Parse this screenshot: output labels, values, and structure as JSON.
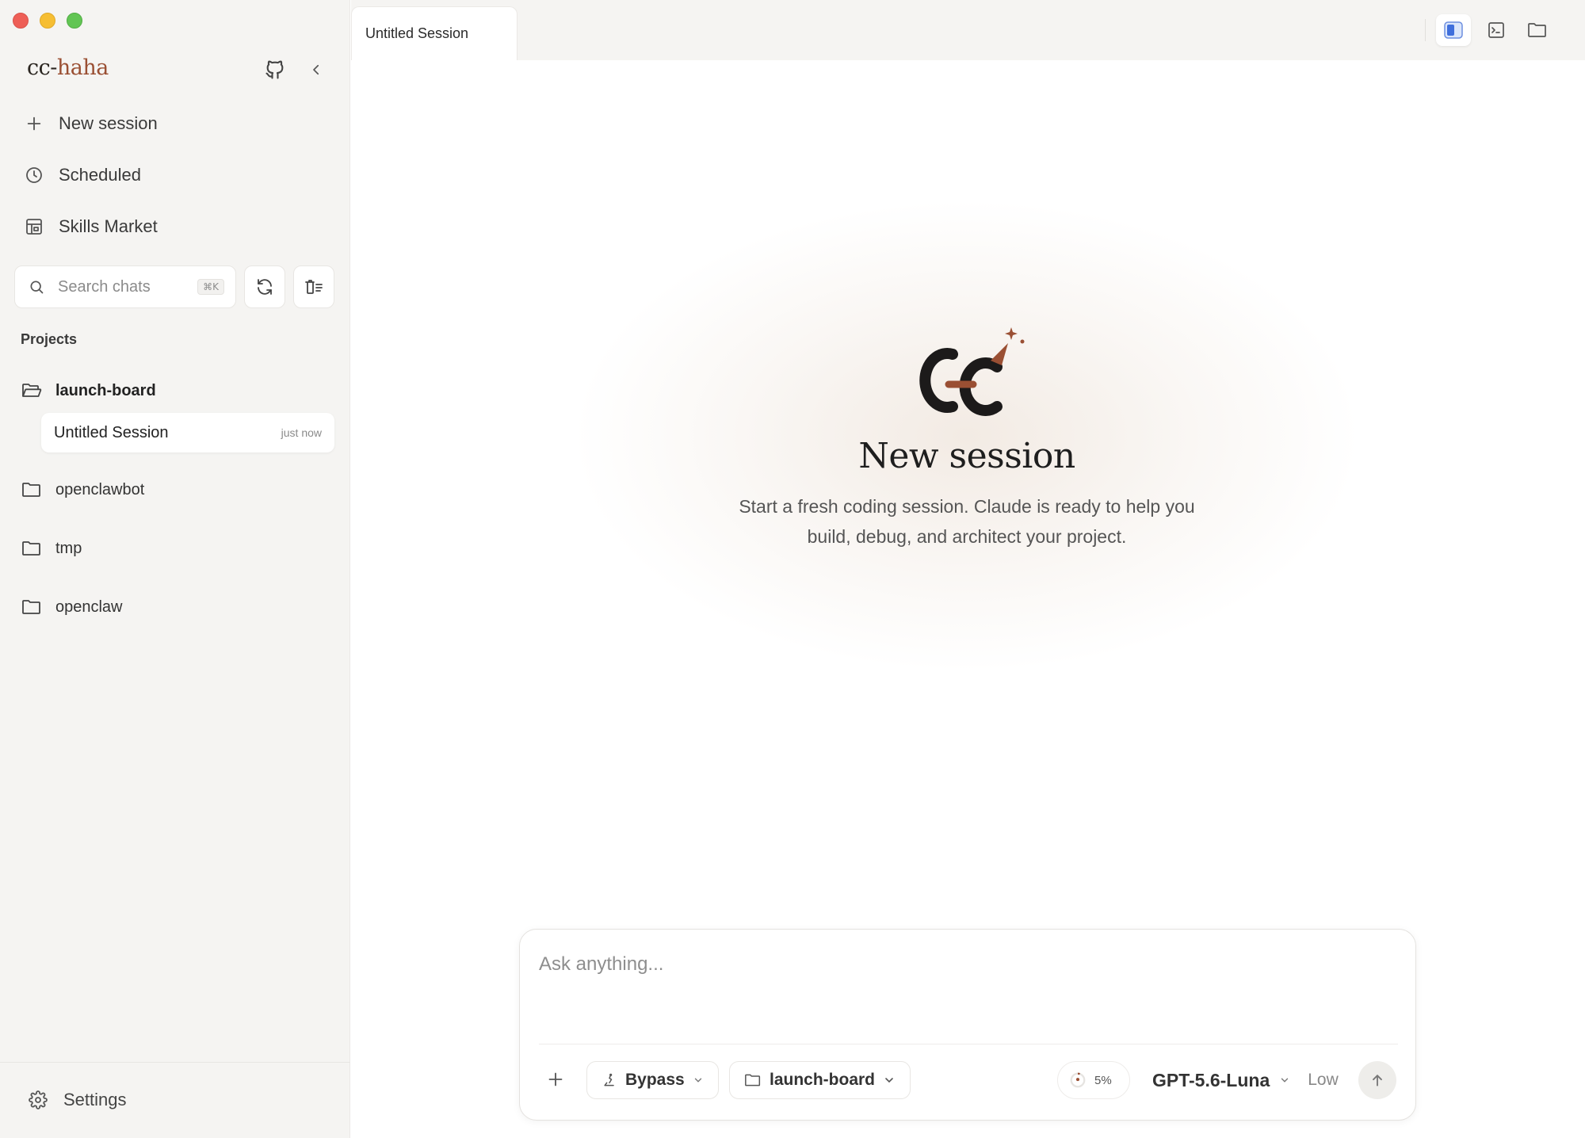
{
  "app": {
    "brand_prefix": "cc-",
    "brand_suffix": "haha",
    "accent_color": "#9a4f33"
  },
  "sidebar": {
    "nav": [
      {
        "label": "New session",
        "icon": "plus-icon"
      },
      {
        "label": "Scheduled",
        "icon": "clock-icon"
      },
      {
        "label": "Skills Market",
        "icon": "store-icon"
      }
    ],
    "search": {
      "placeholder": "Search chats",
      "shortcut": "⌘K"
    },
    "projects_label": "Projects",
    "projects": [
      {
        "name": "launch-board",
        "icon": "folder-open-icon",
        "expanded": true,
        "sessions": [
          {
            "name": "Untitled Session",
            "time": "just now"
          }
        ]
      },
      {
        "name": "openclawbot",
        "icon": "folder-icon"
      },
      {
        "name": "tmp",
        "icon": "folder-icon"
      },
      {
        "name": "openclaw",
        "icon": "folder-icon"
      }
    ],
    "settings_label": "Settings"
  },
  "tabs": [
    {
      "label": "Untitled Session",
      "active": true
    }
  ],
  "toolbar_icons": [
    "panel-icon",
    "terminal-icon",
    "folder-icon"
  ],
  "main": {
    "title": "New session",
    "subtitle_line1": "Start a fresh coding session. Claude is ready to help you",
    "subtitle_line2": "build, debug, and architect your project."
  },
  "composer": {
    "placeholder": "Ask anything...",
    "permission_mode": "Bypass",
    "project": "launch-board",
    "context_usage": "5%",
    "model": "GPT-5.6-Luna",
    "effort": "Low"
  }
}
